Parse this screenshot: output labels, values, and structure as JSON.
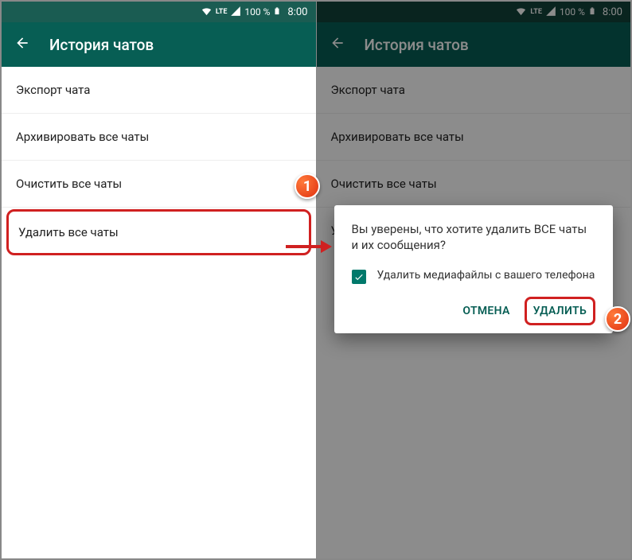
{
  "status": {
    "net_label": "LTE",
    "battery_pct": "100 %",
    "time": "8:00"
  },
  "app_bar": {
    "title": "История чатов"
  },
  "menu": {
    "export": "Экспорт чата",
    "archive": "Архивировать все чаты",
    "clear": "Очистить все чаты",
    "delete": "Удалить все чаты"
  },
  "dialog": {
    "message": "Вы уверены, что хотите удалить ВСЕ чаты и их сообщения?",
    "checkbox_label": "Удалить медиафайлы с вашего телефона",
    "cancel": "ОТМЕНА",
    "confirm": "УДАЛИТЬ"
  },
  "callouts": {
    "one": "1",
    "two": "2"
  }
}
